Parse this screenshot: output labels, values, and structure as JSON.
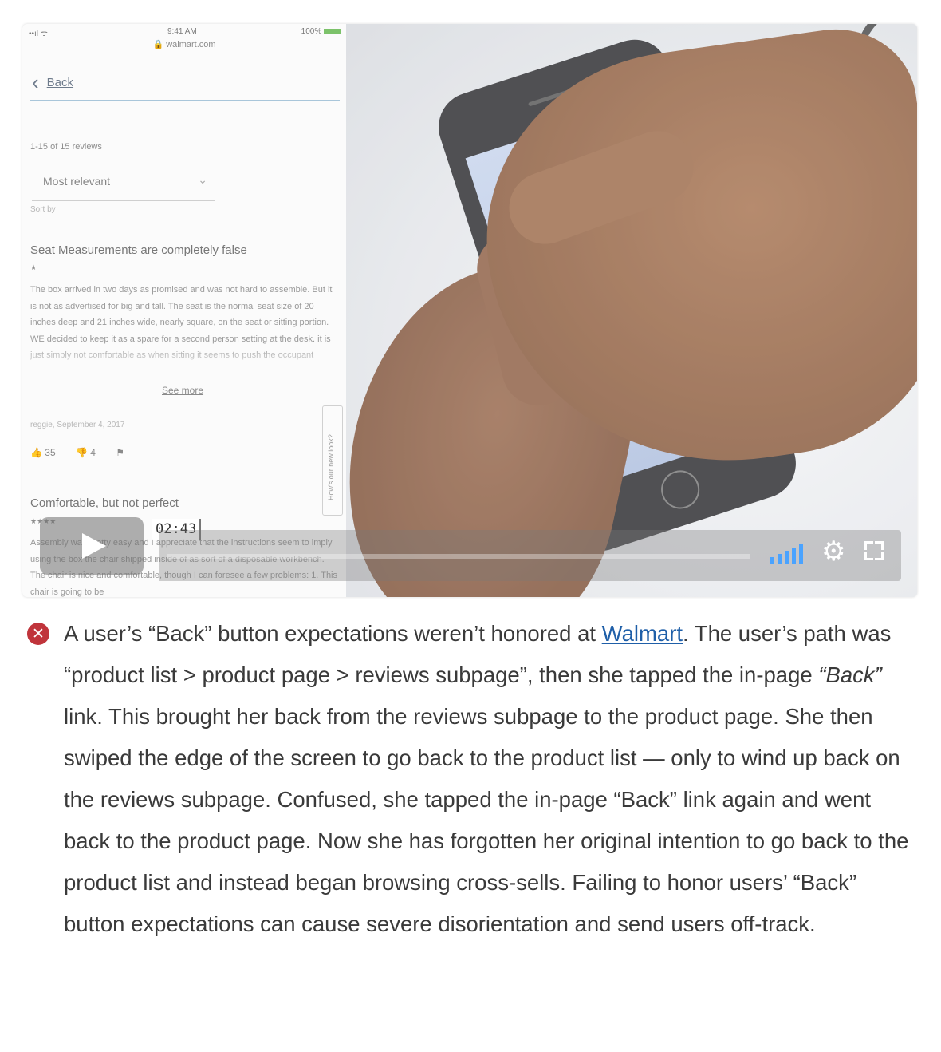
{
  "video": {
    "screenshot": {
      "status": {
        "signal": "••ıl ᯤ",
        "time": "9:41 AM",
        "battery": "100%"
      },
      "url": "🔒 walmart.com",
      "back_chevron": "‹",
      "back_label": "Back",
      "review_count": "1-15 of 15 reviews",
      "sort_value": "Most relevant",
      "sort_chevron": "⌄",
      "sort_label": "Sort by",
      "review1": {
        "title": "Seat Measurements are completely false",
        "stars": "★",
        "body": "The box arrived in two days as promised and was not hard to assemble. But it is not as advertised for big and tall. The seat is the normal seat size of 20 inches deep and 21 inches wide, nearly square, on the seat or sitting portion. WE decided to keep it as a spare for a second person setting at the desk. it is just simply not comfortable as when sitting it seems to push the occupant",
        "see_more": "See more",
        "author": "reggie, September 4, 2017",
        "helpful": "👍 35",
        "unhelpful": "👎 4",
        "flag": "⚑"
      },
      "review2": {
        "title": "Comfortable, but not perfect",
        "stars": "★★★★",
        "body": "Assembly was pretty easy and I appreciate that the instructions seem to imply using the box the chair shipped inside of as sort of a disposable workbench. The chair is nice and comfortable, though I can foresee a few problems: 1. This chair is going to be"
      },
      "feedback_tab": "How's our new look?"
    },
    "player": {
      "time": "02:43",
      "gear_icon": "⚙",
      "accent": "#4aa3ff"
    }
  },
  "caption": {
    "icon": "✕",
    "icon_color": "#c0343b",
    "part1": "A user’s “Back” button expectations weren’t honored at ",
    "link": "Walmart",
    "part2": ". The user’s path was “product list > product page > reviews subpage”, then she tapped the in-page ",
    "emphasis": "“Back”",
    "part3": " link. This brought her back from the reviews subpage to the product page. She then swiped the edge of the screen to go back to the product list — only to wind up back on the reviews subpage. Confused, she tapped the in-page “Back” link again and went back to the product page. Now she has forgotten her original intention to go back to the product list and instead began browsing cross-sells. Failing to honor users’ “Back” button expectations can cause severe disorientation and send users off-track."
  }
}
